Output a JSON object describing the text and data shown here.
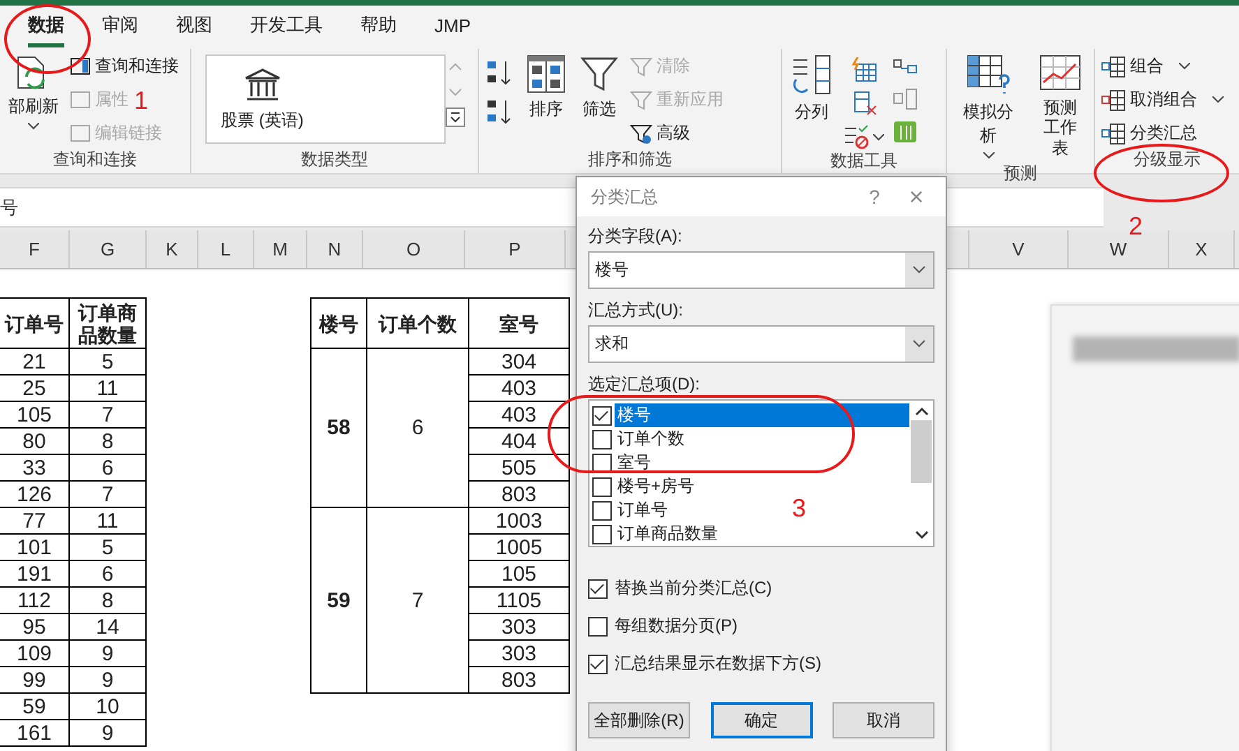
{
  "ribbon": {
    "tabs": [
      {
        "label": "数据",
        "selected": true
      },
      {
        "label": "审阅",
        "selected": false
      },
      {
        "label": "视图",
        "selected": false
      },
      {
        "label": "开发工具",
        "selected": false
      },
      {
        "label": "帮助",
        "selected": false
      },
      {
        "label": "JMP",
        "selected": false
      }
    ],
    "groups": [
      {
        "label": "查询和连接",
        "items": [
          {
            "label": "部刷新",
            "disabled": false
          },
          {
            "label": "查询和连接",
            "disabled": false
          },
          {
            "label": "属性",
            "disabled": true
          },
          {
            "label": "编辑链接",
            "disabled": true
          }
        ]
      },
      {
        "label": "数据类型",
        "items": [
          {
            "label": "股票 (英语)",
            "disabled": false
          }
        ]
      },
      {
        "label": "排序和筛选",
        "items": [
          {
            "label": "排序",
            "disabled": false
          },
          {
            "label": "筛选",
            "disabled": false
          },
          {
            "label": "清除",
            "disabled": true
          },
          {
            "label": "重新应用",
            "disabled": true
          },
          {
            "label": "高级",
            "disabled": false
          }
        ]
      },
      {
        "label": "数据工具",
        "items": [
          {
            "label": "分列",
            "disabled": false
          }
        ]
      },
      {
        "label": "预测",
        "items": [
          {
            "label": "模拟分析",
            "disabled": false
          },
          {
            "lines": [
              "预测",
              "工作表"
            ],
            "disabled": false
          }
        ]
      },
      {
        "label": "分级显示",
        "items": [
          {
            "label": "组合",
            "disabled": false
          },
          {
            "label": "取消组合",
            "disabled": false
          },
          {
            "label": "分类汇总",
            "disabled": false
          }
        ]
      }
    ]
  },
  "formula_bar": {
    "value": "号"
  },
  "column_headers": [
    "F",
    "G",
    "K",
    "L",
    "M",
    "N",
    "O",
    "P",
    "V",
    "W",
    "X"
  ],
  "left_table": {
    "columns": [
      "订单号",
      "订单商品数量"
    ],
    "rows": [
      [
        "21",
        "5"
      ],
      [
        "25",
        "11"
      ],
      [
        "105",
        "7"
      ],
      [
        "80",
        "8"
      ],
      [
        "33",
        "6"
      ],
      [
        "126",
        "7"
      ],
      [
        "77",
        "11"
      ],
      [
        "101",
        "5"
      ],
      [
        "191",
        "6"
      ],
      [
        "112",
        "8"
      ],
      [
        "95",
        "14"
      ],
      [
        "109",
        "9"
      ],
      [
        "99",
        "9"
      ],
      [
        "59",
        "10"
      ],
      [
        "161",
        "9"
      ]
    ]
  },
  "right_table": {
    "columns": [
      "楼号",
      "订单个数",
      "室号"
    ],
    "groups": [
      {
        "building": "58",
        "count": "6",
        "rooms": [
          "304",
          "403",
          "403",
          "404",
          "505",
          "803"
        ]
      },
      {
        "building": "59",
        "count": "7",
        "rooms": [
          "1003",
          "1005",
          "105",
          "1105",
          "303",
          "303",
          "803"
        ]
      }
    ]
  },
  "dialog": {
    "title": "分类汇总",
    "help": "?",
    "close": "×",
    "group_by": {
      "label": "分类字段(A):",
      "value": "楼号"
    },
    "function": {
      "label": "汇总方式(U):",
      "value": "求和"
    },
    "items_label": "选定汇总项(D):",
    "items": [
      {
        "label": "楼号",
        "checked": true,
        "selected": true
      },
      {
        "label": "订单个数",
        "checked": false,
        "selected": false
      },
      {
        "label": "室号",
        "checked": false,
        "selected": false
      },
      {
        "label": "楼号+房号",
        "checked": false,
        "selected": false
      },
      {
        "label": "订单号",
        "checked": false,
        "selected": false
      },
      {
        "label": "订单商品数量",
        "checked": false,
        "selected": false
      }
    ],
    "options": [
      {
        "label": "替换当前分类汇总(C)",
        "checked": true
      },
      {
        "label": "每组数据分页(P)",
        "checked": false
      },
      {
        "label": "汇总结果显示在数据下方(S)",
        "checked": true
      }
    ],
    "buttons": [
      {
        "label": "全部删除(R)",
        "default": false
      },
      {
        "label": "确定",
        "default": true
      },
      {
        "label": "取消",
        "default": false
      }
    ]
  },
  "annotations": [
    {
      "label": "1"
    },
    {
      "label": "2"
    },
    {
      "label": "3"
    }
  ]
}
